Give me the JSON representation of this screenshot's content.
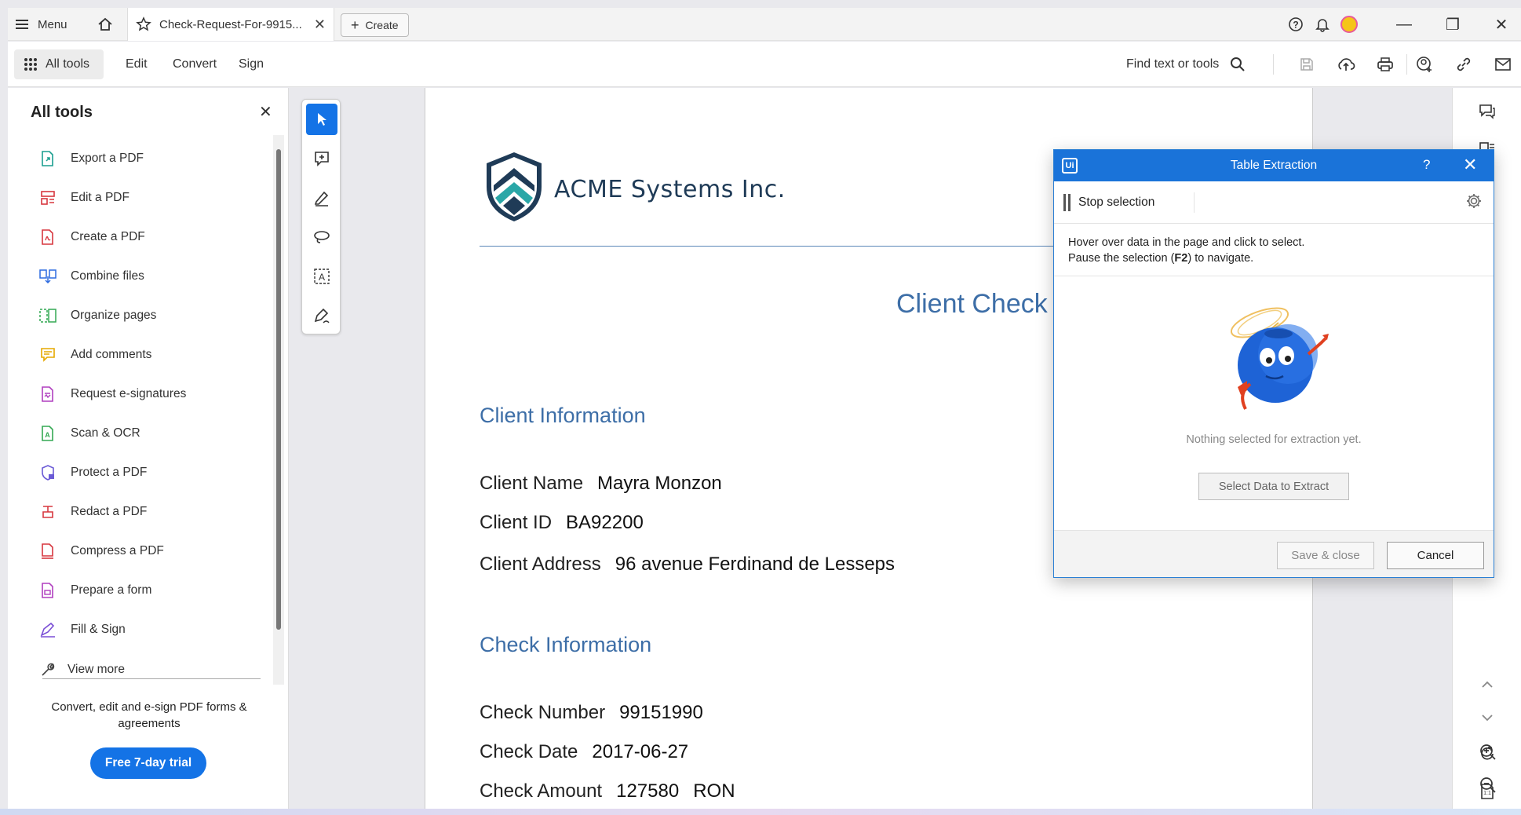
{
  "titlebar": {
    "menu_label": "Menu",
    "tab_title": "Check-Request-For-9915...",
    "create_label": "Create"
  },
  "toolbar": {
    "all_tools": "All tools",
    "edit": "Edit",
    "convert": "Convert",
    "sign": "Sign",
    "find": "Find text or tools"
  },
  "left_panel": {
    "title": "All tools",
    "items": [
      {
        "label": "Export a PDF",
        "icon": "export-pdf-icon",
        "color": "#1a9e8f"
      },
      {
        "label": "Edit a PDF",
        "icon": "edit-pdf-icon",
        "color": "#d7373f"
      },
      {
        "label": "Create a PDF",
        "icon": "create-pdf-icon",
        "color": "#d7373f"
      },
      {
        "label": "Combine files",
        "icon": "combine-files-icon",
        "color": "#2d6be0"
      },
      {
        "label": "Organize pages",
        "icon": "organize-pages-icon",
        "color": "#34a853"
      },
      {
        "label": "Add comments",
        "icon": "add-comments-icon",
        "color": "#e6a800"
      },
      {
        "label": "Request e-signatures",
        "icon": "request-esignatures-icon",
        "color": "#b03fbf"
      },
      {
        "label": "Scan & OCR",
        "icon": "scan-ocr-icon",
        "color": "#34a853"
      },
      {
        "label": "Protect a PDF",
        "icon": "protect-pdf-icon",
        "color": "#6b5bd6"
      },
      {
        "label": "Redact a PDF",
        "icon": "redact-pdf-icon",
        "color": "#d7373f"
      },
      {
        "label": "Compress a PDF",
        "icon": "compress-pdf-icon",
        "color": "#d7373f"
      },
      {
        "label": "Prepare a form",
        "icon": "prepare-form-icon",
        "color": "#b03fbf"
      },
      {
        "label": "Fill & Sign",
        "icon": "fill-sign-icon",
        "color": "#7b4fd6"
      }
    ],
    "view_more": "View more",
    "promo": "Convert, edit and e-sign PDF forms & agreements",
    "trial_button": "Free 7-day trial"
  },
  "document": {
    "company": "ACME Systems Inc.",
    "title": "Client Check C",
    "client_section": "Client Information",
    "client_name_label": "Client Name",
    "client_name": "Mayra Monzon",
    "client_id_label": "Client ID",
    "client_id": "BA92200",
    "client_address_label": "Client Address",
    "client_address": "96 avenue Ferdinand de Lesseps",
    "check_section": "Check Information",
    "check_number_label": "Check Number",
    "check_number": "99151990",
    "check_date_label": "Check Date",
    "check_date": "2017-06-27",
    "check_amount_label": "Check Amount",
    "check_amount": "127580",
    "check_currency": "RON"
  },
  "dialog": {
    "logo": "Ui",
    "title": "Table Extraction",
    "help": "?",
    "stop_selection": "Stop selection",
    "msg_line1": "Hover over data in the page and click to select.",
    "msg_line2_pre": "Pause the selection (",
    "msg_line2_key": "F2",
    "msg_line2_post": ") to navigate.",
    "nothing_selected": "Nothing selected for extraction yet.",
    "select_button": "Select Data to Extract",
    "save_button": "Save & close",
    "cancel_button": "Cancel"
  },
  "colors": {
    "accent": "#1473e6",
    "dialog_header": "#1a73d9",
    "doc_heading": "#3d6ea7"
  }
}
